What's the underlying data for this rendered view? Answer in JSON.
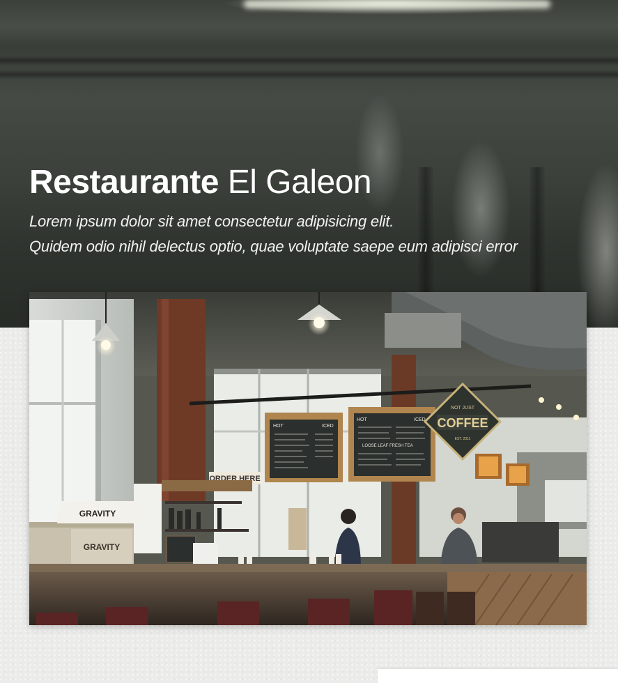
{
  "hero": {
    "title_bold": "Restaurante",
    "title_light": "El Galeon",
    "subtitle_line1": "Lorem ipsum dolor sit amet consectetur adipisicing elit.",
    "subtitle_line2": "Quidem odio nihil delectus optio, quae voluptate saepe eum adipisci error"
  },
  "photo": {
    "sign_order": "ORDER HERE",
    "sign_coffee_top": "NOT JUST",
    "sign_coffee": "COFFEE",
    "sign_coffee_est": "EST. 2011",
    "crate_label": "GRAVITY",
    "board_left_head_1": "HOT",
    "board_left_head_2": "ICED",
    "board_right_head_1": "HOT",
    "board_right_head_2": "ICED",
    "board_right_sub": "LOOSE LEAF FRESH TEA"
  },
  "colors": {
    "page_background": "#ebebea",
    "hero_text": "#ffffff"
  }
}
